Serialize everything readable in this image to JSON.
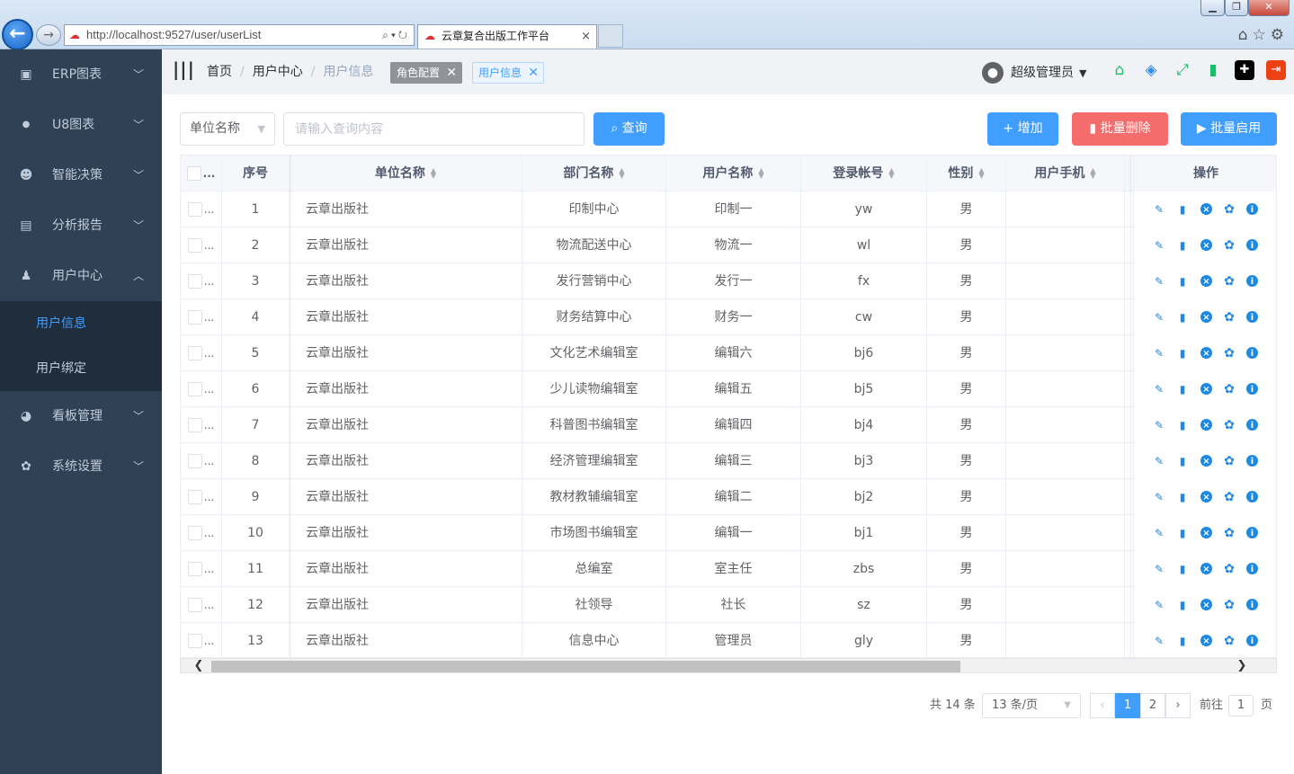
{
  "browser": {
    "url": "http://localhost:9527/user/userList",
    "tab_title": "云章复合出版工作平台",
    "tab_close": "×",
    "back_icon": "arrow-left-icon",
    "forward_icon": "arrow-right-icon"
  },
  "sidebar": {
    "items": [
      {
        "label": "ERP图表",
        "icon": "chart-icon",
        "expanded": false
      },
      {
        "label": "U8图表",
        "icon": "u8-icon",
        "expanded": false
      },
      {
        "label": "智能决策",
        "icon": "brain-icon",
        "expanded": false
      },
      {
        "label": "分析报告",
        "icon": "report-icon",
        "expanded": false
      },
      {
        "label": "用户中心",
        "icon": "user-icon",
        "expanded": true
      },
      {
        "label": "看板管理",
        "icon": "dashboard-icon",
        "expanded": false
      },
      {
        "label": "系统设置",
        "icon": "gear-icon",
        "expanded": false
      }
    ],
    "sub_items": [
      {
        "label": "用户信息",
        "active": true
      },
      {
        "label": "用户绑定",
        "active": false
      }
    ]
  },
  "navbar": {
    "breadcrumb": [
      "首页",
      "用户中心",
      "用户信息"
    ],
    "tags": [
      {
        "label": "角色配置",
        "active": false
      },
      {
        "label": "用户信息",
        "active": true
      }
    ],
    "user_name": "超级管理员",
    "icons": [
      "home-icon",
      "layers-icon",
      "fullscreen-icon",
      "bar-chart-icon",
      "shirt-icon",
      "logout-icon"
    ]
  },
  "toolbar": {
    "select_value": "单位名称",
    "search_placeholder": "请输入查询内容",
    "query_label": "查询",
    "add_label": "增加",
    "batch_delete_label": "批量删除",
    "batch_enable_label": "批量启用"
  },
  "table": {
    "headers": {
      "index": "序号",
      "unit": "单位名称",
      "dept": "部门名称",
      "user": "用户名称",
      "login": "登录帐号",
      "gender": "性别",
      "phone": "用户手机",
      "ops": "操作"
    },
    "rows": [
      {
        "index": "1",
        "unit": "云章出版社",
        "dept": "印制中心",
        "user": "印制一",
        "login": "yw",
        "gender": "男",
        "phone": ""
      },
      {
        "index": "2",
        "unit": "云章出版社",
        "dept": "物流配送中心",
        "user": "物流一",
        "login": "wl",
        "gender": "男",
        "phone": ""
      },
      {
        "index": "3",
        "unit": "云章出版社",
        "dept": "发行营销中心",
        "user": "发行一",
        "login": "fx",
        "gender": "男",
        "phone": ""
      },
      {
        "index": "4",
        "unit": "云章出版社",
        "dept": "财务结算中心",
        "user": "财务一",
        "login": "cw",
        "gender": "男",
        "phone": ""
      },
      {
        "index": "5",
        "unit": "云章出版社",
        "dept": "文化艺术编辑室",
        "user": "编辑六",
        "login": "bj6",
        "gender": "男",
        "phone": ""
      },
      {
        "index": "6",
        "unit": "云章出版社",
        "dept": "少儿读物编辑室",
        "user": "编辑五",
        "login": "bj5",
        "gender": "男",
        "phone": ""
      },
      {
        "index": "7",
        "unit": "云章出版社",
        "dept": "科普图书编辑室",
        "user": "编辑四",
        "login": "bj4",
        "gender": "男",
        "phone": ""
      },
      {
        "index": "8",
        "unit": "云章出版社",
        "dept": "经济管理编辑室",
        "user": "编辑三",
        "login": "bj3",
        "gender": "男",
        "phone": ""
      },
      {
        "index": "9",
        "unit": "云章出版社",
        "dept": "教材教辅编辑室",
        "user": "编辑二",
        "login": "bj2",
        "gender": "男",
        "phone": ""
      },
      {
        "index": "10",
        "unit": "云章出版社",
        "dept": "市场图书编辑室",
        "user": "编辑一",
        "login": "bj1",
        "gender": "男",
        "phone": ""
      },
      {
        "index": "11",
        "unit": "云章出版社",
        "dept": "总编室",
        "user": "室主任",
        "login": "zbs",
        "gender": "男",
        "phone": ""
      },
      {
        "index": "12",
        "unit": "云章出版社",
        "dept": "社领导",
        "user": "社长",
        "login": "sz",
        "gender": "男",
        "phone": ""
      },
      {
        "index": "13",
        "unit": "云章出版社",
        "dept": "信息中心",
        "user": "管理员",
        "login": "gly",
        "gender": "男",
        "phone": ""
      }
    ],
    "row_action_icons": [
      "edit-icon",
      "delete-icon",
      "disable-icon",
      "settings-icon",
      "info-icon"
    ]
  },
  "pagination": {
    "total_text": "共 14 条",
    "page_size": "13 条/页",
    "pages": [
      "1",
      "2"
    ],
    "current_page": "1",
    "goto_label": "前往",
    "goto_value": "1",
    "page_suffix": "页"
  },
  "colors": {
    "sidebar_bg": "#304156",
    "submenu_bg": "#1f2d3d",
    "primary": "#409eff",
    "danger": "#f56c6c"
  }
}
